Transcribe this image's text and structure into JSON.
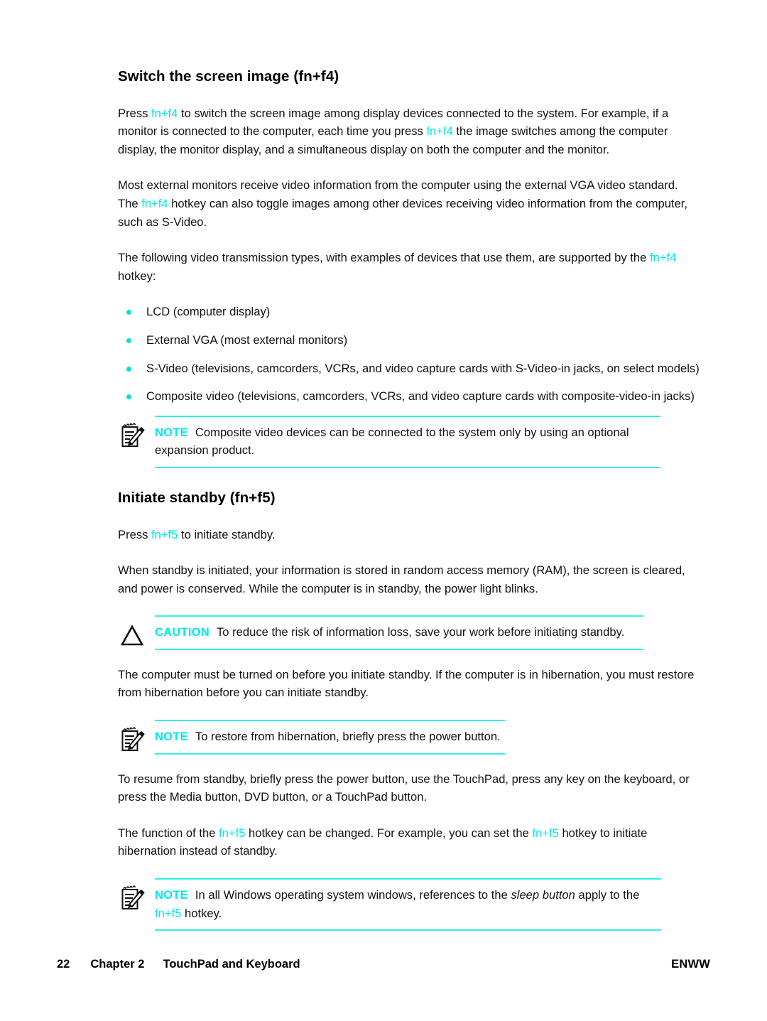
{
  "document": {
    "sections": [
      {
        "heading": "Switch the screen image (fn+f4)",
        "paragraphs": [
          {
            "id": "p1",
            "parts": [
              {
                "t": "Press ",
                "style": "normal"
              },
              {
                "t": "fn+f4",
                "style": "hotkey"
              },
              {
                "t": " to switch the screen image among display devices connected to the system. For example, if a monitor is connected to the computer, each time you press ",
                "style": "normal"
              },
              {
                "t": "fn+f4",
                "style": "hotkey"
              },
              {
                "t": " the image switches among the computer display, the monitor display, and a simultaneous display on both the computer and the monitor.",
                "style": "normal"
              }
            ]
          },
          {
            "id": "p2",
            "parts": [
              {
                "t": "Most external monitors receive video information from the computer using the external VGA video standard. The ",
                "style": "normal"
              },
              {
                "t": "fn+f4",
                "style": "hotkey"
              },
              {
                "t": " hotkey can also toggle images among other devices receiving video information from the computer, such as S-Video.",
                "style": "normal"
              }
            ]
          },
          {
            "id": "p3",
            "parts": [
              {
                "t": "The following video transmission types, with examples of devices that use them, are supported by the ",
                "style": "normal"
              },
              {
                "t": "fn+f4",
                "style": "hotkey"
              },
              {
                "t": " hotkey:",
                "style": "normal"
              }
            ]
          }
        ],
        "bullets": [
          "LCD (computer display)",
          "External VGA (most external monitors)",
          "S-Video (televisions, camcorders, VCRs, and video capture cards with S-Video-in jacks, on select models)",
          "Composite video (televisions, camcorders, VCRs, and video capture cards with composite-video-in jacks)"
        ],
        "note": {
          "keyword": "NOTE",
          "icon": "note-pencil-icon",
          "text": "Composite video devices can be connected to the system only by using an optional expansion product."
        }
      },
      {
        "heading": "Initiate standby (fn+f5)",
        "paragraphs": [
          {
            "id": "p4",
            "parts": [
              {
                "t": "Press ",
                "style": "normal"
              },
              {
                "t": "fn+f5",
                "style": "hotkey"
              },
              {
                "t": " to initiate standby.",
                "style": "normal"
              }
            ]
          },
          {
            "id": "p5",
            "parts": [
              {
                "t": "When standby is initiated, your information is stored in random access memory (RAM), the screen is cleared, and power is conserved. While the computer is in standby, the power light blinks.",
                "style": "normal"
              }
            ]
          }
        ],
        "caution": {
          "keyword": "CAUTION",
          "icon": "caution-triangle-icon",
          "text": "To reduce the risk of information loss, save your work before initiating standby."
        },
        "paragraphs_after_caution": [
          {
            "id": "p6",
            "parts": [
              {
                "t": "The computer must be turned on before you initiate standby. If the computer is in hibernation, you must restore from hibernation before you can initiate standby.",
                "style": "normal"
              }
            ]
          }
        ],
        "note2": {
          "keyword": "NOTE",
          "icon": "note-pencil-icon",
          "text": "To restore from hibernation, briefly press the power button."
        },
        "paragraphs_after_note2": [
          {
            "id": "p7",
            "parts": [
              {
                "t": "To resume from standby, briefly press the power button, use the TouchPad, press any key on the keyboard, or press the Media button, DVD button, or a TouchPad button.",
                "style": "normal"
              }
            ]
          },
          {
            "id": "p8",
            "parts": [
              {
                "t": "The function of the ",
                "style": "normal"
              },
              {
                "t": "fn+f5",
                "style": "hotkey"
              },
              {
                "t": " hotkey can be changed. For example, you can set the ",
                "style": "normal"
              },
              {
                "t": "fn+f5",
                "style": "hotkey"
              },
              {
                "t": " hotkey to initiate hibernation instead of standby.",
                "style": "normal"
              }
            ]
          }
        ],
        "note3": {
          "keyword": "NOTE",
          "icon": "note-pencil-icon",
          "parts": [
            {
              "t": "In all Windows operating system windows, references to the ",
              "style": "normal"
            },
            {
              "t": "sleep button",
              "style": "italic"
            },
            {
              "t": " apply to the ",
              "style": "normal"
            },
            {
              "t": "fn+f5",
              "style": "hotkey"
            },
            {
              "t": " hotkey.",
              "style": "normal"
            }
          ]
        }
      }
    ]
  },
  "footer": {
    "page_number": "22",
    "chapter": "Chapter 2",
    "chapter_title": "TouchPad and Keyboard",
    "locale_code": "ENWW"
  },
  "colors": {
    "hotkey_cyan": "#00e8e8",
    "rule_cyan": "#2ff0e8",
    "bullet_cyan": "#00e0dc",
    "text_black": "#000000",
    "page_background": "#ffffff"
  }
}
